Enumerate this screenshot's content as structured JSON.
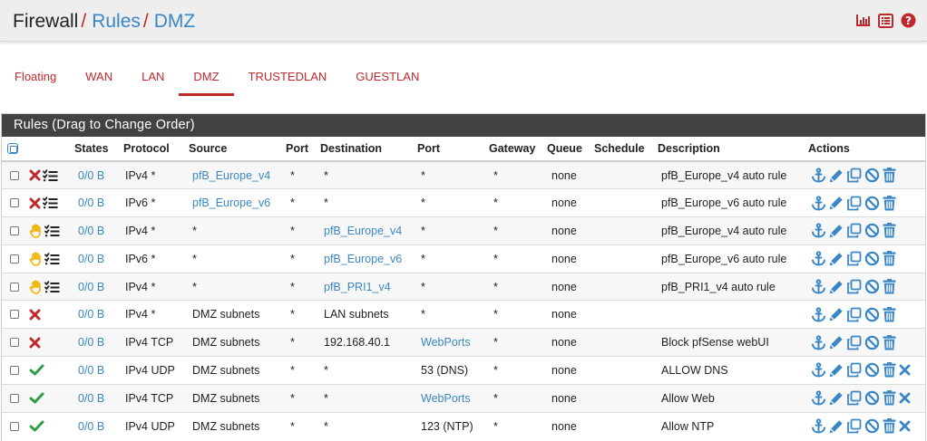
{
  "breadcrumb": [
    {
      "label": "Firewall",
      "link": false
    },
    {
      "label": "Rules",
      "link": true
    },
    {
      "label": "DMZ",
      "link": true
    }
  ],
  "top_icons": [
    "chart-icon",
    "list-icon",
    "help-icon"
  ],
  "tabs": [
    {
      "label": "Floating",
      "active": false
    },
    {
      "label": "WAN",
      "active": false
    },
    {
      "label": "LAN",
      "active": false
    },
    {
      "label": "DMZ",
      "active": true
    },
    {
      "label": "TRUSTEDLAN",
      "active": false
    },
    {
      "label": "GUESTLAN",
      "active": false
    }
  ],
  "panel_title": "Rules (Drag to Change Order)",
  "columns": [
    "",
    "",
    "States",
    "Protocol",
    "Source",
    "Port",
    "Destination",
    "Port",
    "Gateway",
    "Queue",
    "Schedule",
    "Description",
    "Actions"
  ],
  "colors": {
    "accent_red": "#c0282b",
    "link_blue": "#3b87c5",
    "pass_green": "#2f9e44",
    "header_dark": "#424242"
  },
  "rules": [
    {
      "status": "block",
      "states": "0/0 B",
      "protocol": "IPv4 *",
      "source": "pfB_Europe_v4",
      "source_link": true,
      "sport": "*",
      "destination": "*",
      "dest_link": false,
      "dport": "*",
      "dport_link": false,
      "gateway": "*",
      "queue": "none",
      "schedule": "",
      "description": "pfB_Europe_v4 auto rule",
      "deletable_x": false
    },
    {
      "status": "block",
      "states": "0/0 B",
      "protocol": "IPv6 *",
      "source": "pfB_Europe_v6",
      "source_link": true,
      "sport": "*",
      "destination": "*",
      "dest_link": false,
      "dport": "*",
      "dport_link": false,
      "gateway": "*",
      "queue": "none",
      "schedule": "",
      "description": "pfB_Europe_v6 auto rule",
      "deletable_x": false
    },
    {
      "status": "hand",
      "states": "0/0 B",
      "protocol": "IPv4 *",
      "source": "*",
      "source_link": false,
      "sport": "*",
      "destination": "pfB_Europe_v4",
      "dest_link": true,
      "dport": "*",
      "dport_link": false,
      "gateway": "*",
      "queue": "none",
      "schedule": "",
      "description": "pfB_Europe_v4 auto rule",
      "deletable_x": false
    },
    {
      "status": "hand",
      "states": "0/0 B",
      "protocol": "IPv6 *",
      "source": "*",
      "source_link": false,
      "sport": "*",
      "destination": "pfB_Europe_v6",
      "dest_link": true,
      "dport": "*",
      "dport_link": false,
      "gateway": "*",
      "queue": "none",
      "schedule": "",
      "description": "pfB_Europe_v6 auto rule",
      "deletable_x": false
    },
    {
      "status": "hand",
      "states": "0/0 B",
      "protocol": "IPv4 *",
      "source": "*",
      "source_link": false,
      "sport": "*",
      "destination": "pfB_PRI1_v4",
      "dest_link": true,
      "dport": "*",
      "dport_link": false,
      "gateway": "*",
      "queue": "none",
      "schedule": "",
      "description": "pfB_PRI1_v4 auto rule",
      "deletable_x": false
    },
    {
      "status": "reject",
      "states": "0/0 B",
      "protocol": "IPv4 *",
      "source": "DMZ subnets",
      "source_link": false,
      "sport": "*",
      "destination": "LAN subnets",
      "dest_link": false,
      "dport": "*",
      "dport_link": false,
      "gateway": "*",
      "queue": "none",
      "schedule": "",
      "description": "",
      "deletable_x": false
    },
    {
      "status": "reject",
      "states": "0/0 B",
      "protocol": "IPv4 TCP",
      "source": "DMZ subnets",
      "source_link": false,
      "sport": "*",
      "destination": "192.168.40.1",
      "dest_link": false,
      "dport": "WebPorts",
      "dport_link": true,
      "gateway": "*",
      "queue": "none",
      "schedule": "",
      "description": "Block pfSense webUI",
      "deletable_x": false
    },
    {
      "status": "pass",
      "states": "0/0 B",
      "protocol": "IPv4 UDP",
      "source": "DMZ subnets",
      "source_link": false,
      "sport": "*",
      "destination": "*",
      "dest_link": false,
      "dport": "53 (DNS)",
      "dport_link": false,
      "gateway": "*",
      "queue": "none",
      "schedule": "",
      "description": "ALLOW DNS",
      "deletable_x": true
    },
    {
      "status": "pass",
      "states": "0/0 B",
      "protocol": "IPv4 TCP",
      "source": "DMZ subnets",
      "source_link": false,
      "sport": "*",
      "destination": "*",
      "dest_link": false,
      "dport": "WebPorts",
      "dport_link": true,
      "gateway": "*",
      "queue": "none",
      "schedule": "",
      "description": "Allow Web",
      "deletable_x": true
    },
    {
      "status": "pass",
      "states": "0/0 B",
      "protocol": "IPv4 UDP",
      "source": "DMZ subnets",
      "source_link": false,
      "sport": "*",
      "destination": "*",
      "dest_link": false,
      "dport": "123 (NTP)",
      "dport_link": false,
      "gateway": "*",
      "queue": "none",
      "schedule": "",
      "description": "Allow NTP",
      "deletable_x": true
    }
  ]
}
